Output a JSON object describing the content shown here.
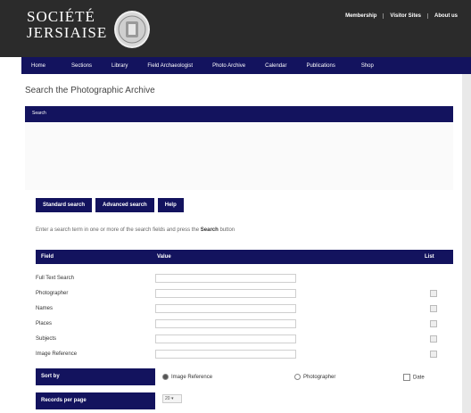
{
  "header": {
    "logo_line1": "SOCIÉTÉ",
    "logo_line2": "JERSIAISE",
    "links": [
      "Membership",
      "Visitor Sites",
      "About us"
    ]
  },
  "nav": [
    "Home",
    "Sections",
    "Library",
    "Field Archaeologist",
    "Photo Archive",
    "Calendar",
    "Publications",
    "Shop"
  ],
  "page_title": "Search the Photographic Archive",
  "search_bar_label": "Search",
  "buttons": {
    "standard": "Standard search",
    "advanced": "Advanced search",
    "help": "Help"
  },
  "instructions": {
    "before": "Enter a search term in one or more of the search fields and press the ",
    "bold": "Search",
    "after": " button"
  },
  "table": {
    "col_field": "Field",
    "col_value": "Value",
    "col_list": "List",
    "rows": [
      {
        "label": "Full Text Search"
      },
      {
        "label": "Photographer"
      },
      {
        "label": "Names"
      },
      {
        "label": "Places"
      },
      {
        "label": "Subjects"
      },
      {
        "label": "Image Reference"
      }
    ]
  },
  "sort": {
    "label": "Sort by",
    "options": [
      "Image Reference",
      "Photographer",
      "Date"
    ],
    "selected": "Image Reference"
  },
  "records": {
    "label": "Records per page",
    "value": "20"
  },
  "colors": {
    "navy": "#13135e",
    "header_bg": "#2b2b2b"
  }
}
